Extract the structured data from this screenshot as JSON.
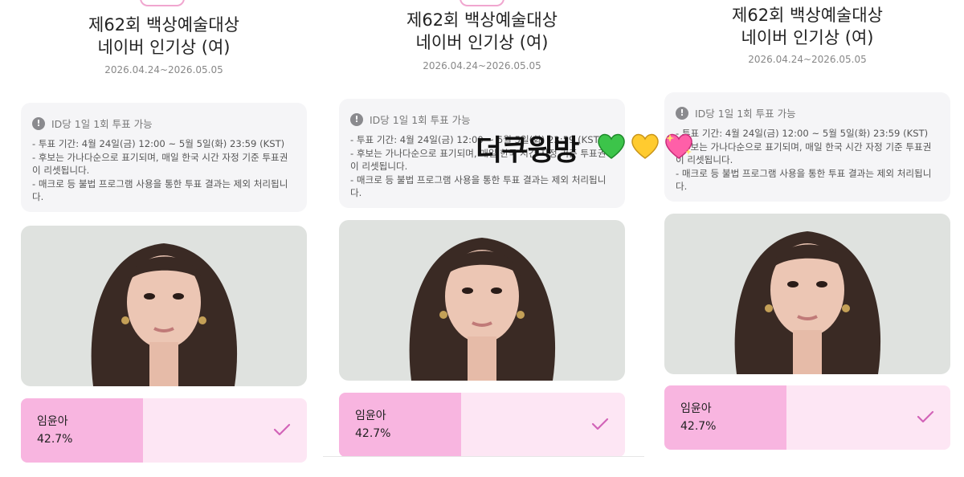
{
  "panels": [
    {
      "title_line1": "제62회 백상예술대상",
      "title_line2": "네이버 인기상 (여)",
      "dates": "2026.04.24~2026.05.05",
      "notice_head": "ID당 1일 1회 투표 가능",
      "notice_lines": [
        "- 투표 기간: 4월 24일(금) 12:00 ~ 5월 5일(화) 23:59 (KST)",
        "- 후보는 가나다순으로 표기되며, 매일 한국 시간 자정 기준 투표권이 리셋됩니다.",
        "- 매크로 등 불법 프로그램 사용을 통한 투표 결과는 제외 처리됩니다."
      ],
      "candidate_name": "임윤아",
      "candidate_percent": "42.7%",
      "percent_value": 42.7
    },
    {
      "title_line1": "제62회 백상예술대상",
      "title_line2": "네이버 인기상 (여)",
      "dates": "2026.04.24~2026.05.05",
      "notice_head": "ID당 1일 1회 투표 가능",
      "notice_lines": [
        "- 투표 기간: 4월 24일(금) 12:00 ~ 5월 5일(화) 23:59 (KST)",
        "- 후보는 가나다순으로 표기되며, 매일 한국 시간 자정 기준 투표권이 리셋됩니다.",
        "- 매크로 등 불법 프로그램 사용을 통한 투표 결과는 제외 처리됩니다."
      ],
      "candidate_name": "임윤아",
      "candidate_percent": "42.7%",
      "percent_value": 42.7
    },
    {
      "title_line1": "제62회 백상예술대상",
      "title_line2": "네이버 인기상 (여)",
      "dates": "2026.04.24~2026.05.05",
      "notice_head": "ID당 1일 1회 투표 가능",
      "notice_lines": [
        "- 투표 기간: 4월 24일(금) 12:00 ~ 5월 5일(화) 23:59 (KST)",
        "- 후보는 가나다순으로 표기되며, 매일 한국 시간 자정 기준 투표권이 리셋됩니다.",
        "- 매크로 등 불법 프로그램 사용을 통한 투표 결과는 제외 처리됩니다."
      ],
      "candidate_name": "임윤아",
      "candidate_percent": "42.7%",
      "percent_value": 42.7
    }
  ],
  "overlay": {
    "caption": "더쿠윙방",
    "emoji_icons": [
      "green-heart-icon",
      "yellow-heart-icon",
      "sparkling-heart-icon"
    ]
  },
  "colors": {
    "accent_pink": "#f8b5e0",
    "result_bg": "#fde6f4",
    "check": "#d264b8"
  }
}
